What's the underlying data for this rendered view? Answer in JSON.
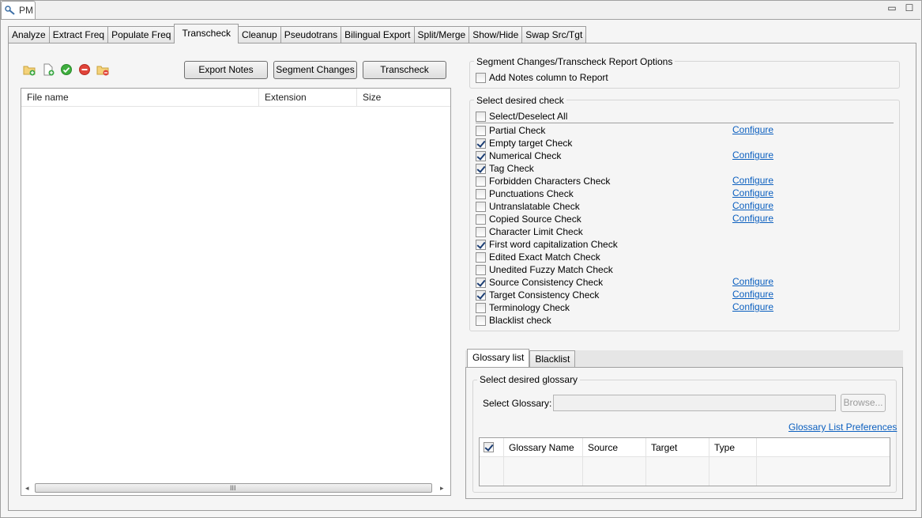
{
  "window": {
    "view_title": "PM",
    "controls": {
      "minimize": "▭",
      "maximize": "☐",
      "close": "✕"
    }
  },
  "tabs": [
    {
      "label": "Analyze"
    },
    {
      "label": "Extract Freq"
    },
    {
      "label": "Populate Freq"
    },
    {
      "label": "Transcheck",
      "active": true
    },
    {
      "label": "Cleanup"
    },
    {
      "label": "Pseudotrans"
    },
    {
      "label": "Bilingual Export"
    },
    {
      "label": "Split/Merge"
    },
    {
      "label": "Show/Hide"
    },
    {
      "label": "Swap Src/Tgt"
    }
  ],
  "toolbar": {
    "icons": [
      "add-folder-icon",
      "add-file-icon",
      "check-all-icon",
      "remove-icon",
      "remove-folder-icon"
    ],
    "export_notes": "Export Notes",
    "segment_changes": "Segment Changes",
    "transcheck": "Transcheck"
  },
  "file_table": {
    "columns": [
      "File name",
      "Extension",
      "Size"
    ],
    "scroll_grip": "III"
  },
  "report_options": {
    "title": "Segment Changes/Transcheck Report Options",
    "add_notes_label": "Add Notes column to Report"
  },
  "checks": {
    "title": "Select desired check",
    "select_all_label": "Select/Deselect All",
    "configure_label": "Configure",
    "items": [
      {
        "label": "Partial Check",
        "checked": false,
        "configurable": true
      },
      {
        "label": "Empty target Check",
        "checked": true,
        "configurable": false
      },
      {
        "label": "Numerical Check",
        "checked": true,
        "configurable": true
      },
      {
        "label": "Tag Check",
        "checked": true,
        "configurable": false
      },
      {
        "label": "Forbidden Characters Check",
        "checked": false,
        "configurable": true
      },
      {
        "label": "Punctuations Check",
        "checked": false,
        "configurable": true
      },
      {
        "label": "Untranslatable Check",
        "checked": false,
        "configurable": true
      },
      {
        "label": "Copied Source Check",
        "checked": false,
        "configurable": true
      },
      {
        "label": "Character Limit Check",
        "checked": false,
        "configurable": false
      },
      {
        "label": "First word capitalization Check",
        "checked": true,
        "configurable": false
      },
      {
        "label": "Edited Exact Match Check",
        "checked": false,
        "configurable": false
      },
      {
        "label": "Unedited Fuzzy Match Check",
        "checked": false,
        "configurable": false
      },
      {
        "label": "Source Consistency Check",
        "checked": true,
        "configurable": true
      },
      {
        "label": "Target Consistency Check",
        "checked": true,
        "configurable": true
      },
      {
        "label": "Terminology Check",
        "checked": false,
        "configurable": true
      },
      {
        "label": "Blacklist check",
        "checked": false,
        "configurable": false
      }
    ]
  },
  "glossary": {
    "tabs": [
      "Glossary list",
      "Blacklist"
    ],
    "group_title": "Select desired glossary",
    "select_label": "Select Glossary:",
    "select_value": "",
    "browse_label": "Browse...",
    "preferences_link": "Glossary List Preferences",
    "columns": [
      "Glossary Name",
      "Source",
      "Target",
      "Type"
    ],
    "header_checked": true
  }
}
